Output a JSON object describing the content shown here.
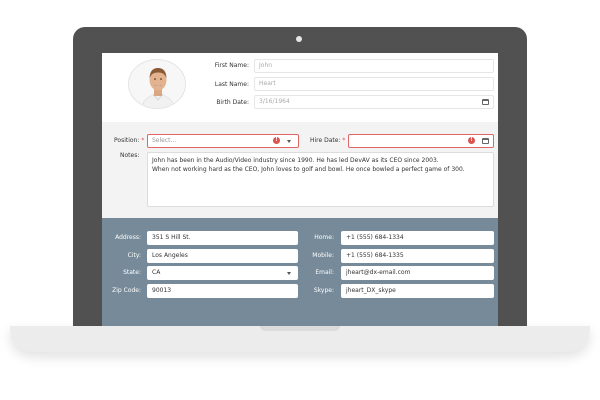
{
  "employee": {
    "first_name_label": "First Name:",
    "first_name_value": "John",
    "last_name_label": "Last Name:",
    "last_name_value": "Heart",
    "birth_date_label": "Birth Date:",
    "birth_date_value": "3/16/1964"
  },
  "job": {
    "position_label": "Position:",
    "position_placeholder": "Select...",
    "hire_date_label": "Hire Date:",
    "required_mark": "*",
    "notes_label": "Notes:",
    "notes_line1": "John has been in the Audio/Video industry since 1990. He has led DevAV as its CEO since 2003.",
    "notes_line2": "When not working hard as the CEO, John loves to golf and bowl. He once bowled a perfect game of 300."
  },
  "address": {
    "address_label": "Address:",
    "address_value": "351 S Hill St.",
    "city_label": "City:",
    "city_value": "Los Angeles",
    "state_label": "State:",
    "state_value": "CA",
    "zip_label": "Zip Code:",
    "zip_value": "90013"
  },
  "contact": {
    "home_label": "Home:",
    "home_value": "+1 (555) 684-1334",
    "mobile_label": "Mobile:",
    "mobile_value": "+1 (555) 684-1335",
    "email_label": "Email:",
    "email_value": "jheart@dx-email.com",
    "skype_label": "Skype:",
    "skype_value": "jheart_DX_skype"
  },
  "icons": {
    "error": "!",
    "photo": "employee-photo",
    "calendar": "calendar-icon",
    "dropdown": "chevron-down-icon"
  },
  "colors": {
    "contact_band": "#768a99",
    "laptop_frame": "#515151",
    "error": "#d9534f"
  }
}
